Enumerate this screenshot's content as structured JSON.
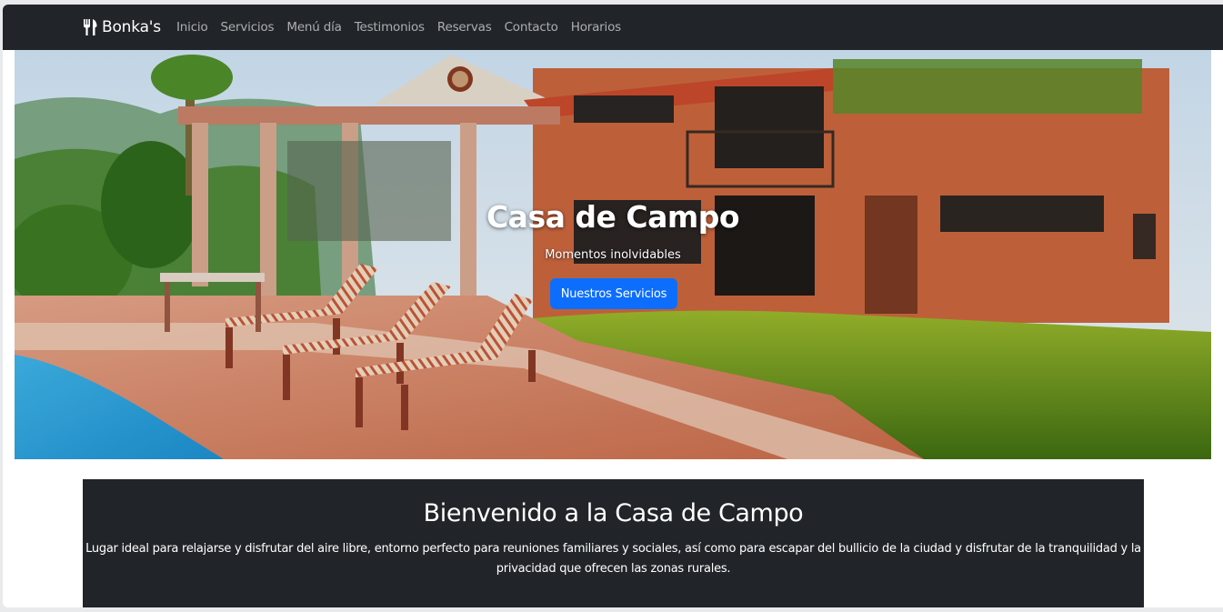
{
  "navbar": {
    "brand_icon": "utensils-icon",
    "brand": "Bonka's",
    "links": [
      "Inicio",
      "Servicios",
      "Menú día",
      "Testimonios",
      "Reservas",
      "Contacto",
      "Horarios"
    ]
  },
  "hero": {
    "title": "Casa de Campo",
    "subtitle": "Momentos inolvidables",
    "button": "Nuestros Servicios"
  },
  "welcome": {
    "title": "Bienvenido a la Casa de Campo",
    "text": "Lugar ideal para relajarse y disfrutar del aire libre, entorno perfecto para reuniones familiares y sociales, así como para escapar del bullicio de la ciudad y disfrutar de la tranquilidad y la privacidad que ofrecen las zonas rurales."
  },
  "colors": {
    "navbar_bg": "#212529",
    "primary": "#0d6efd",
    "section_bg": "#212529"
  }
}
